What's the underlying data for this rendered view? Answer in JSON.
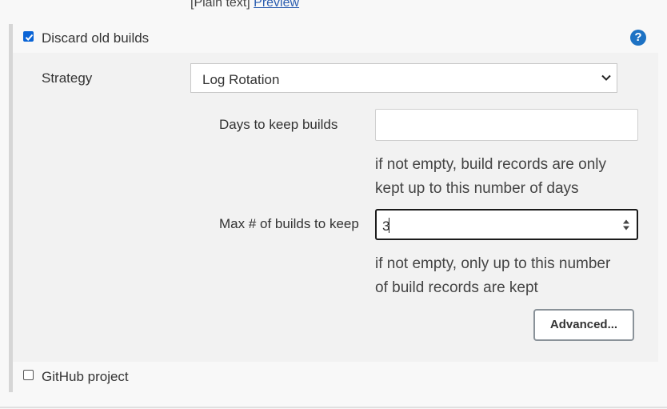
{
  "header": {
    "plain_text": "[Plain text]",
    "preview_link": "Preview"
  },
  "discard": {
    "checkbox_label": "Discard old builds",
    "checked": true,
    "help_icon": "question-circle-icon",
    "strategy_label": "Strategy",
    "strategy_value": "Log Rotation",
    "days_label": "Days to keep builds",
    "days_value": "",
    "days_help_1": "if not empty, build records are only",
    "days_help_2": "kept up to this number of days",
    "max_label": "Max # of builds to keep",
    "max_value": "3",
    "max_help_1": "if not empty, only up to this number",
    "max_help_2": "of build records are kept",
    "advanced_label": "Advanced..."
  },
  "github": {
    "checkbox_label": "GitHub project",
    "checked": false
  },
  "colors": {
    "accent": "#0a64d6",
    "help": "#1d72c4",
    "section_bg": "#f2f2f2",
    "page_bg": "#f8f8f8"
  }
}
